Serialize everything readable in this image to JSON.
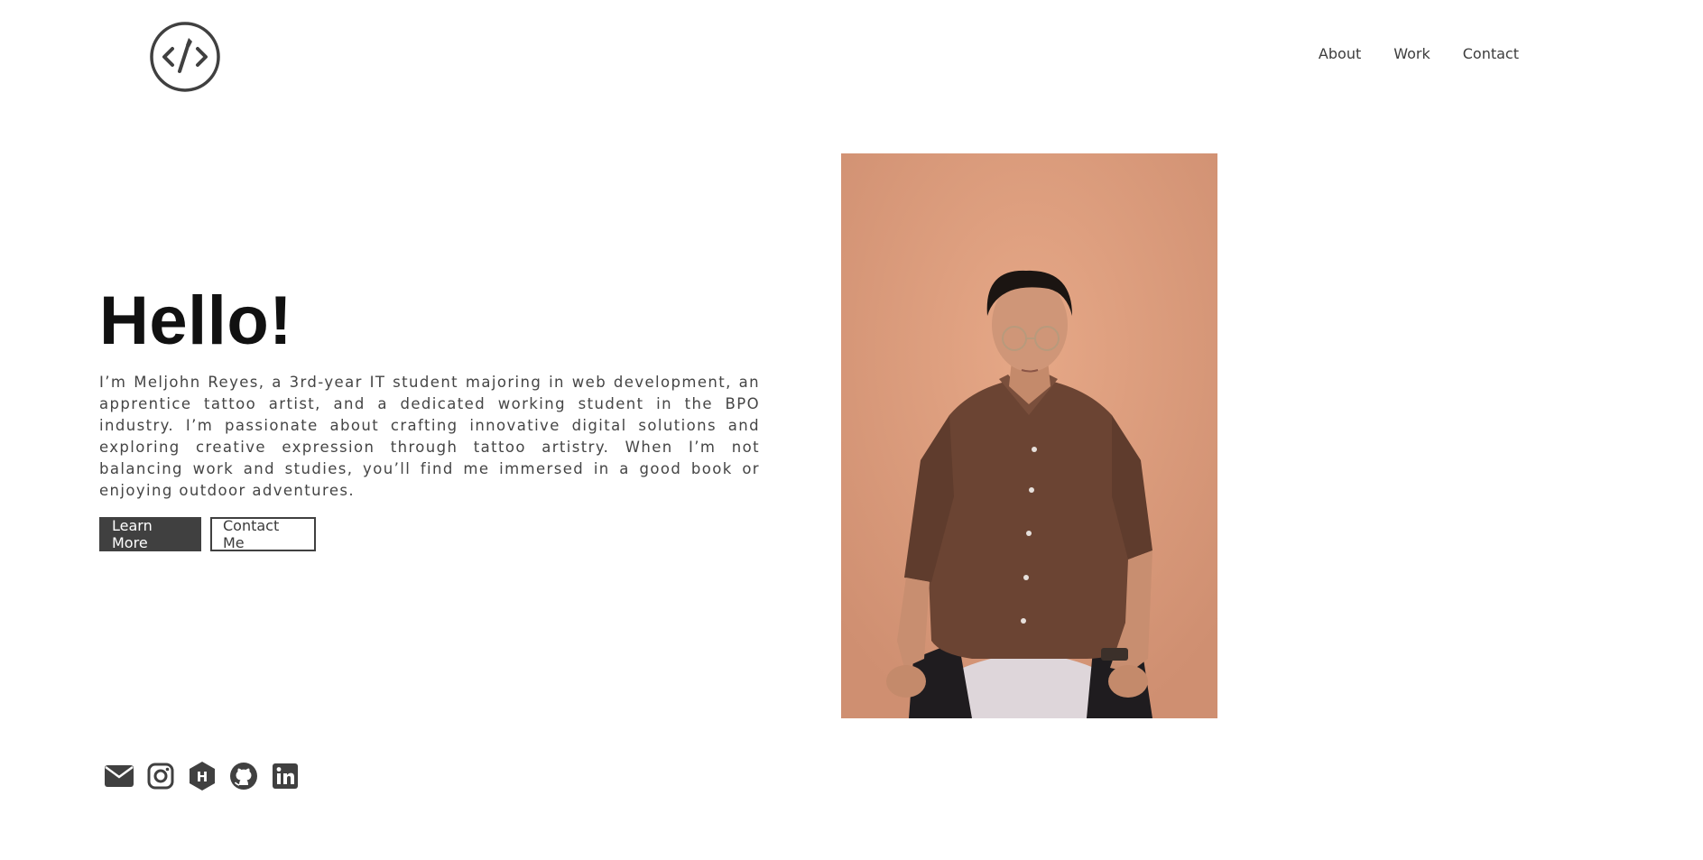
{
  "header": {
    "logo_icon": "code-brush-logo",
    "nav": [
      {
        "label": "About"
      },
      {
        "label": "Work"
      },
      {
        "label": "Contact"
      }
    ]
  },
  "hero": {
    "title": "Hello!",
    "description": "I’m Meljohn Reyes, a 3rd-year IT student majoring in web development, an apprentice tattoo artist, and a dedicated working student in the BPO industry. I’m passionate about crafting innovative digital solutions and exploring creative expression through tattoo artistry. When I’m not balancing work and studies, you’ll find me immersed in a good book or enjoying outdoor adventures.",
    "primary_button": "Learn More",
    "secondary_button": "Contact Me"
  },
  "social": [
    {
      "icon": "email-icon"
    },
    {
      "icon": "instagram-icon"
    },
    {
      "icon": "hashnode-icon"
    },
    {
      "icon": "github-icon"
    },
    {
      "icon": "linkedin-icon"
    }
  ],
  "colors": {
    "accent": "#404040",
    "photo_background": "#e4a584",
    "text": "#3a3a3a"
  }
}
